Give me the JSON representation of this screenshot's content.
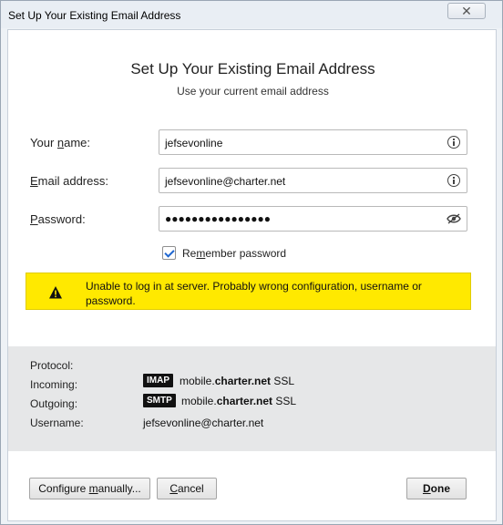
{
  "window": {
    "title": "Set Up Your Existing Email Address",
    "close_glyph": "✕"
  },
  "header": {
    "title": "Set Up Your Existing Email Address",
    "subtitle": "Use your current email address"
  },
  "form": {
    "name": {
      "label_pre": "Your ",
      "label_key": "n",
      "label_post": "ame:",
      "value": "jefsevonline"
    },
    "email": {
      "label_pre": "",
      "label_key": "E",
      "label_post": "mail address:",
      "value": "jefsevonline@charter.net"
    },
    "password": {
      "label_pre": "",
      "label_key": "P",
      "label_post": "assword:",
      "value": "●●●●●●●●●●●●●●●●"
    },
    "remember": {
      "checked": true,
      "label_pre": "Re",
      "label_key": "m",
      "label_post": "ember password"
    }
  },
  "warning": {
    "message": "Unable to log in at server. Probably wrong configuration, username or password.",
    "color": "#ffe900"
  },
  "summary": {
    "protocol_label": "Protocol:",
    "incoming_label": "Incoming:",
    "outgoing_label": "Outgoing:",
    "username_label": "Username:",
    "incoming": {
      "protocol": "IMAP",
      "host_prefix": "mobile.",
      "host_domain": "charter.net",
      "security": "SSL"
    },
    "outgoing": {
      "protocol": "SMTP",
      "host_prefix": "mobile.",
      "host_domain": "charter.net",
      "security": "SSL"
    },
    "username": "jefsevonline@charter.net"
  },
  "buttons": {
    "configure_pre": "Configure ",
    "configure_key": "m",
    "configure_post": "anually...",
    "cancel_pre": "",
    "cancel_key": "C",
    "cancel_post": "ancel",
    "done_pre": "",
    "done_key": "D",
    "done_post": "one"
  }
}
